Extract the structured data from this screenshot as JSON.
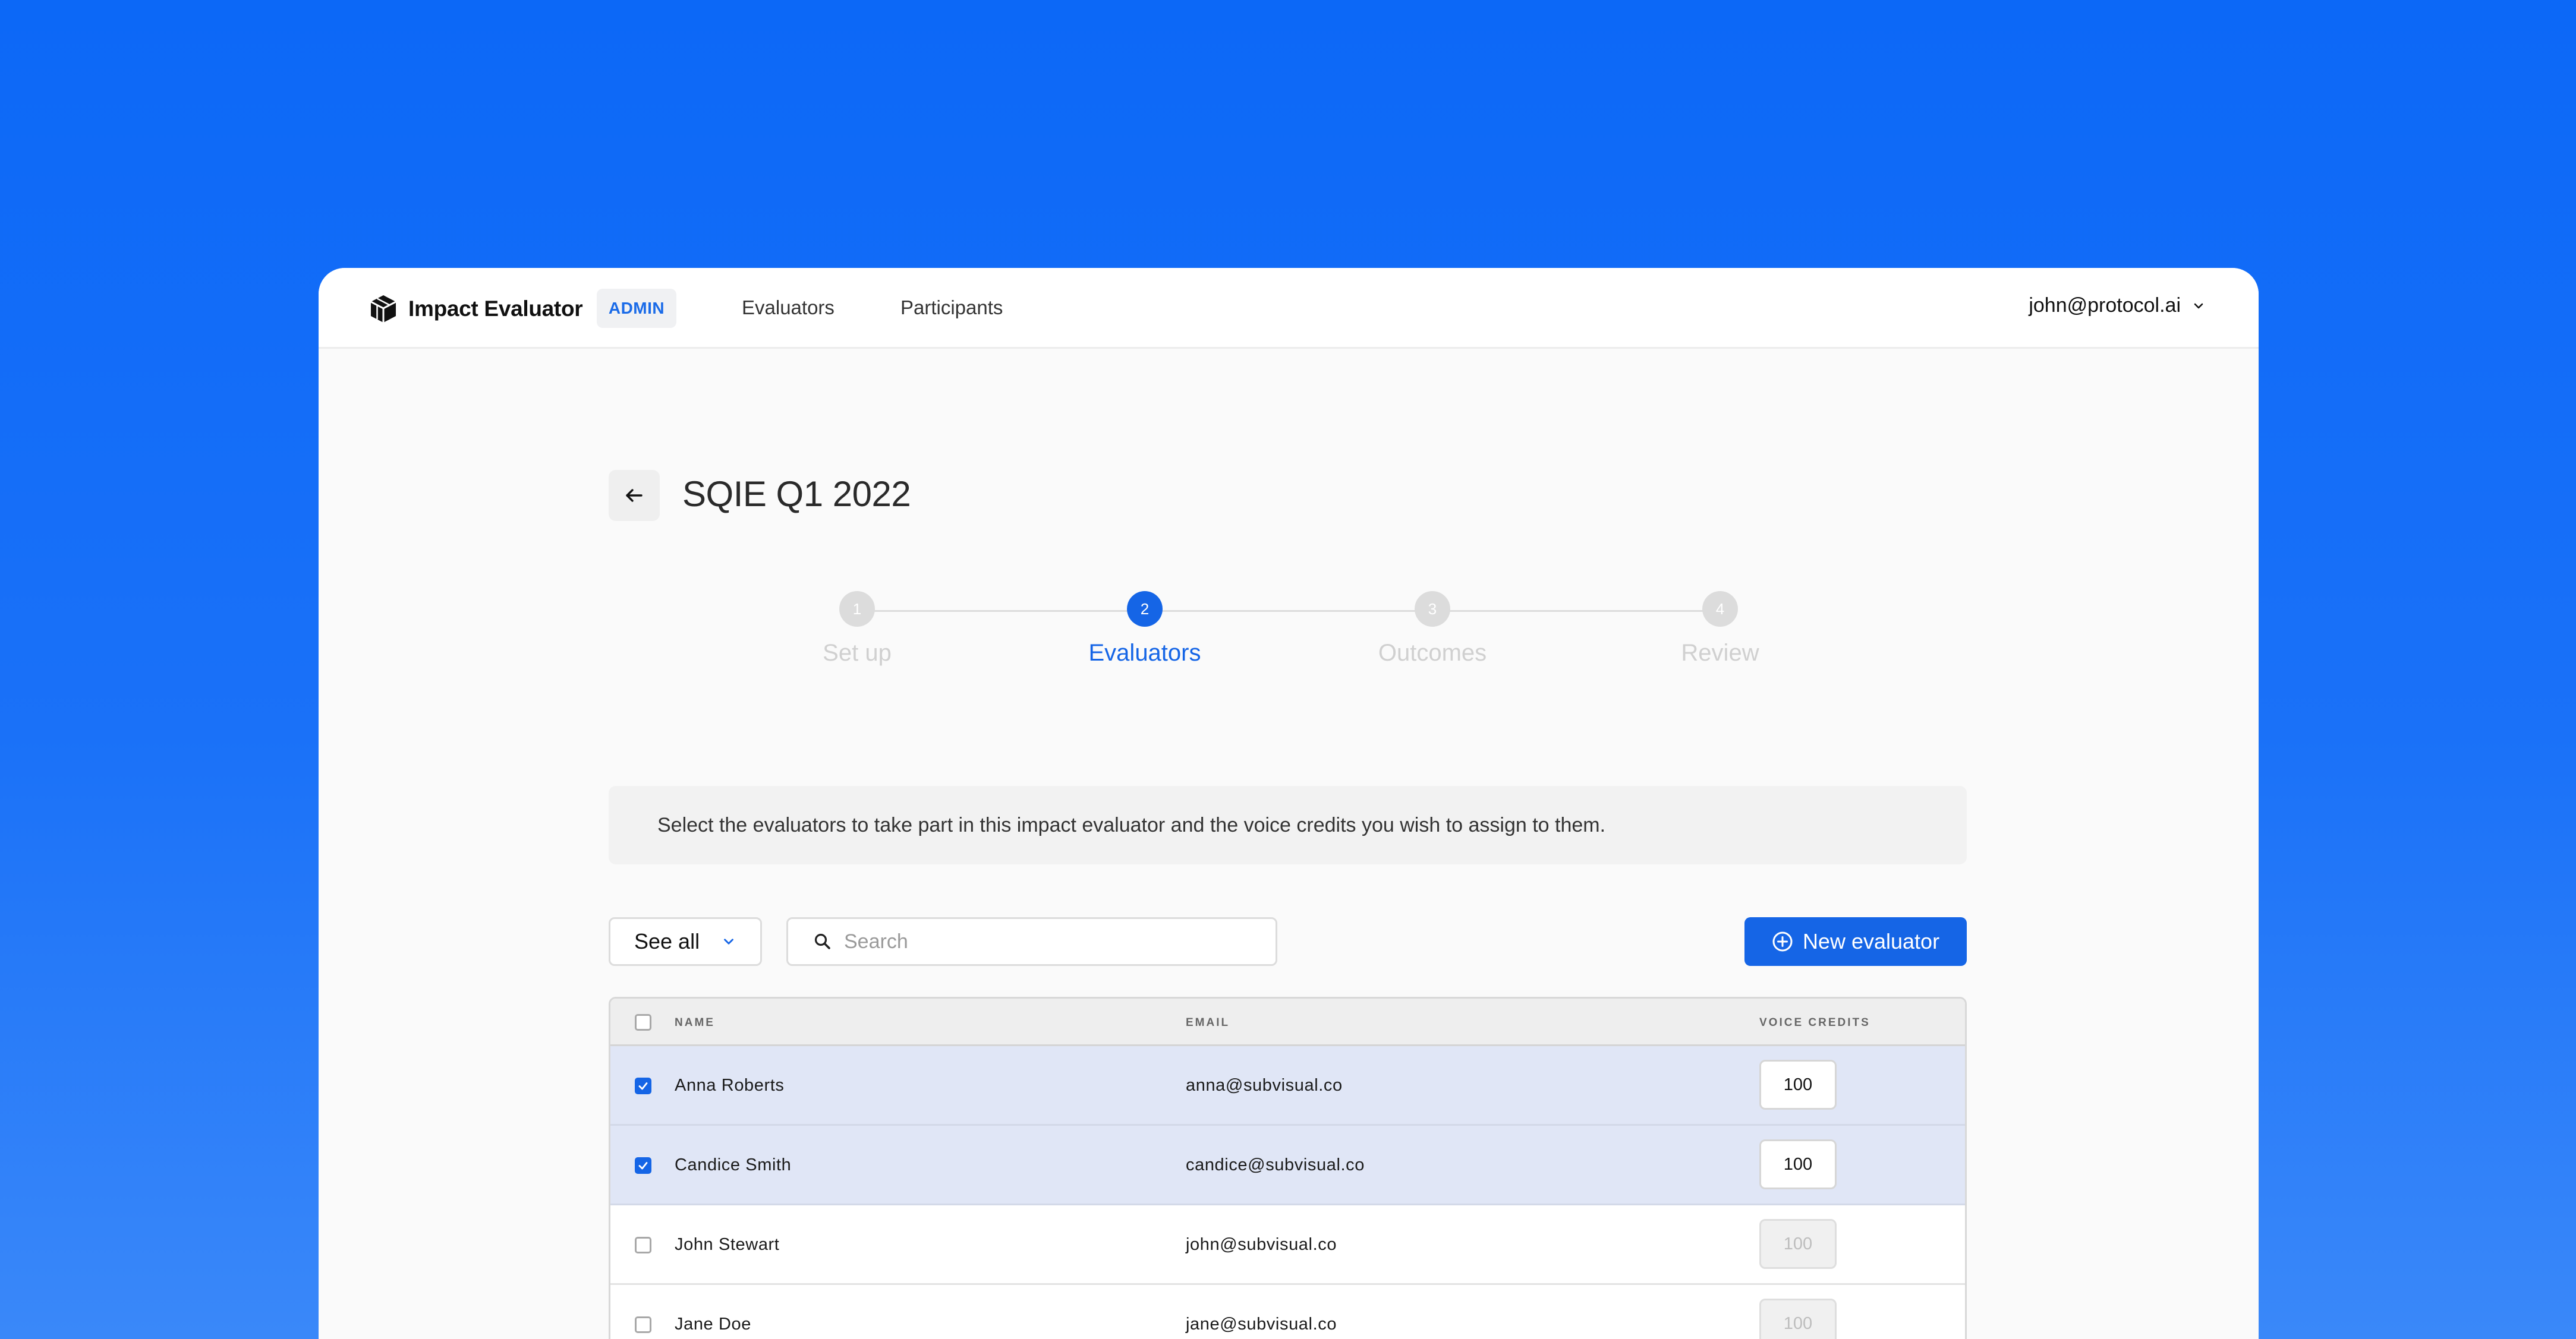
{
  "header": {
    "app_title": "Impact Evaluator",
    "badge": "ADMIN",
    "nav": [
      "Evaluators",
      "Participants"
    ],
    "user_email": "john@protocol.ai"
  },
  "page": {
    "title": "SQIE Q1 2022"
  },
  "stepper": {
    "active_step": 2,
    "steps": [
      {
        "number": "1",
        "label": "Set up"
      },
      {
        "number": "2",
        "label": "Evaluators"
      },
      {
        "number": "3",
        "label": "Outcomes"
      },
      {
        "number": "4",
        "label": "Review"
      }
    ]
  },
  "info": {
    "text": "Select the evaluators to take part in this impact evaluator and the voice credits you wish to assign to them."
  },
  "toolbar": {
    "filter_value": "See all",
    "search_placeholder": "Search",
    "search_value": "",
    "new_button_label": "New evaluator"
  },
  "table": {
    "columns": [
      "NAME",
      "EMAIL",
      "VOICE CREDITS"
    ],
    "rows": [
      {
        "name": "Anna Roberts",
        "email": "anna@subvisual.co",
        "credits": "100",
        "selected": true
      },
      {
        "name": "Candice Smith",
        "email": "candice@subvisual.co",
        "credits": "100",
        "selected": true
      },
      {
        "name": "John Stewart",
        "email": "john@subvisual.co",
        "credits": "100",
        "selected": false
      },
      {
        "name": "Jane Doe",
        "email": "jane@subvisual.co",
        "credits": "100",
        "selected": false
      }
    ]
  },
  "colors": {
    "primary": "#1565e6",
    "background_gradient_top": "#0c68f7",
    "selected_row": "#e0e6f6",
    "inactive_step": "#dcdcdc"
  },
  "icons": {
    "logo": "cube-logo-icon",
    "back": "arrow-left-icon",
    "user_menu": "chevron-down-icon",
    "filter": "chevron-down-icon",
    "search": "search-icon",
    "new_button": "plus-circle-icon",
    "checkbox": "check-icon"
  }
}
